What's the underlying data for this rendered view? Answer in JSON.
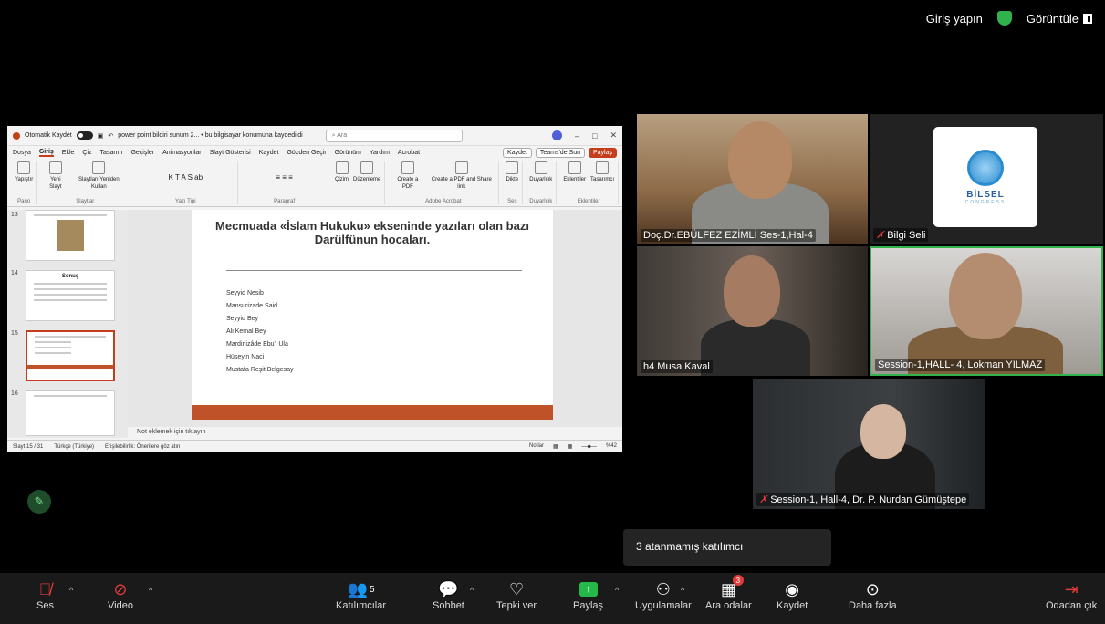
{
  "top": {
    "signin": "Giriş yapın",
    "view": "Görüntüle"
  },
  "ppt": {
    "autosave": "Otomatik Kaydet",
    "filename": "power point bildiri sunum 2... • bu bilgisayar konumuna kaydedildi",
    "search": "Ara",
    "tabs": [
      "Dosya",
      "Giriş",
      "Ekle",
      "Çiz",
      "Tasarım",
      "Geçişler",
      "Animasyonlar",
      "Slayt Gösterisi",
      "Kaydet",
      "Gözden Geçir",
      "Görünüm",
      "Yardım",
      "Acrobat"
    ],
    "tab_buttons": [
      "Kaydet",
      "Teams'de Sun",
      "Paylaş"
    ],
    "ribbon": [
      {
        "name": "Pano",
        "buttons": [
          "Yapıştır"
        ]
      },
      {
        "name": "Slaytlar",
        "buttons": [
          "Yeni Slayt",
          "Slaytları Yeniden Kullan"
        ]
      },
      {
        "name": "Yazı Tipi",
        "buttons": [
          "K T A S ab"
        ]
      },
      {
        "name": "Paragraf",
        "buttons": [
          "≡ ≡ ≡"
        ]
      },
      {
        "name": "",
        "buttons": [
          "Çizim",
          "Düzenleme"
        ]
      },
      {
        "name": "Adobe Acrobat",
        "buttons": [
          "Create a PDF",
          "Create a PDF and Share link"
        ]
      },
      {
        "name": "Ses",
        "buttons": [
          "Dikte"
        ]
      },
      {
        "name": "Duyarlılık",
        "buttons": [
          "Duyarlılık"
        ]
      },
      {
        "name": "Eklentiler",
        "buttons": [
          "Eklentiler",
          "Tasarımcı"
        ]
      }
    ],
    "thumb_numbers": [
      "13",
      "14",
      "15",
      "16"
    ],
    "thumb14_title": "Sonuç",
    "slide_title": "Mecmuada «İslam Hukuku» ekseninde yazıları olan bazı Darülfünun hocaları.",
    "slide_items": [
      "Seyyid Nesib",
      "Mansurizade Said",
      "Seyyid Bey",
      "Ali Kemal Bey",
      "Mardinizâde Ebu'l Ula",
      "Hüseyin Naci",
      "Mustafa Reşit Belgesay"
    ],
    "notes": "Not eklemek için tıklayın",
    "status": {
      "slide": "Slayt 15 / 31",
      "lang": "Türkçe (Türkiye)",
      "access": "Erişilebilirlik: Önerilere göz atın",
      "notes": "Notlar",
      "zoom": "%42"
    }
  },
  "tiles": [
    {
      "name": "Doç.Dr.EBÜLFEZ EZİMLİ Ses-1,Hal-4",
      "muted": false
    },
    {
      "name": "Bilgi Seli",
      "muted": true
    },
    {
      "name": "h4 Musa Kaval",
      "muted": false
    },
    {
      "name": "Session-1,HALL- 4, Lokman YILMAZ",
      "muted": false
    },
    {
      "name": "Session-1, Hall-4, Dr. P. Nurdan Gümüştepe",
      "muted": true
    }
  ],
  "logo": {
    "text": "BİLSEL",
    "sub": "CONGRESS"
  },
  "tooltip": "3 atanmamış katılımcı",
  "toolbar": {
    "audio": "Ses",
    "video": "Video",
    "participants": "Katılımcılar",
    "participants_count": "5",
    "chat": "Sohbet",
    "react": "Tepki ver",
    "share": "Paylaş",
    "apps": "Uygulamalar",
    "breakout": "Ara odalar",
    "breakout_badge": "3",
    "record": "Kaydet",
    "more": "Daha fazla",
    "leave": "Odadan çık"
  }
}
